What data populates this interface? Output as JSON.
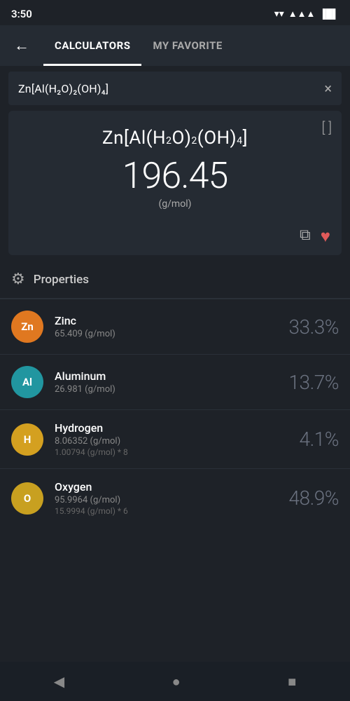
{
  "statusBar": {
    "time": "3:50"
  },
  "navigation": {
    "backLabel": "←",
    "tabs": [
      {
        "id": "calculators",
        "label": "CALCULATORS",
        "active": true
      },
      {
        "id": "favorite",
        "label": "MY FAVORITE",
        "active": false
      }
    ]
  },
  "searchBar": {
    "value": "Zn[Al(H₂O)₂(OH)₄]",
    "clearLabel": "×"
  },
  "formulaCard": {
    "bracketLabel": "[ ]",
    "formulaDisplay": "Zn[Al(H₂O)₂(OH)₄]",
    "molarMass": "196.45",
    "unit": "(g/mol)",
    "copyLabel": "⧉",
    "favoriteLabel": "♥"
  },
  "propertiesSection": {
    "title": "Properties",
    "elements": [
      {
        "symbol": "Zn",
        "name": "Zinc",
        "mass": "65.409 (g/mol)",
        "detail": "",
        "percent": "33.3%",
        "badgeClass": "badge-zinc"
      },
      {
        "symbol": "Al",
        "name": "Aluminum",
        "mass": "26.981 (g/mol)",
        "detail": "",
        "percent": "13.7%",
        "badgeClass": "badge-aluminum"
      },
      {
        "symbol": "H",
        "name": "Hydrogen",
        "mass": "8.06352 (g/mol)",
        "detail": "1.00794 (g/mol) * 8",
        "percent": "4.1%",
        "badgeClass": "badge-hydrogen"
      },
      {
        "symbol": "O",
        "name": "Oxygen",
        "mass": "95.9964 (g/mol)",
        "detail": "15.9994 (g/mol) * 6",
        "percent": "48.9%",
        "badgeClass": "badge-oxygen"
      }
    ]
  },
  "bottomNav": {
    "back": "◀",
    "home": "●",
    "recent": "■"
  }
}
